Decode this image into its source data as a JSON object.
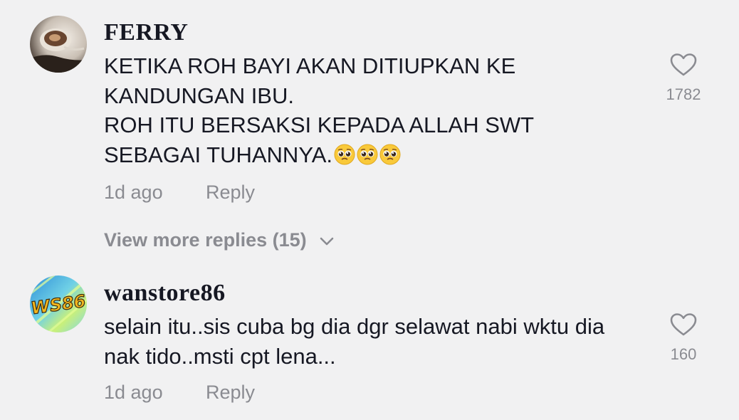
{
  "comments": [
    {
      "username": "FERRY",
      "lines": [
        "KETIKA ROH BAYI AKAN DITIUPKAN KE",
        "KANDUNGAN IBU.",
        "ROH ITU BERSAKSI KEPADA ALLAH SWT",
        "SEBAGAI TUHANNYA."
      ],
      "emoji": [
        "pleading-face",
        "pleading-face",
        "pleading-face"
      ],
      "time": "1d ago",
      "reply_label": "Reply",
      "like_count": "1782",
      "view_more": "View more replies (15)"
    },
    {
      "username": "wanstore86",
      "avatar_text": "WS86",
      "lines": [
        "selain itu..sis cuba bg dia dgr selawat nabi wktu dia",
        "nak tido..msti cpt lena..."
      ],
      "time": "1d ago",
      "reply_label": "Reply",
      "like_count": "160"
    }
  ],
  "icons": {
    "like": "heart-outline-icon",
    "expand": "chevron-down-icon"
  },
  "colors": {
    "background": "#f1f1f2",
    "text": "#161823",
    "muted": "#8a8b91"
  }
}
